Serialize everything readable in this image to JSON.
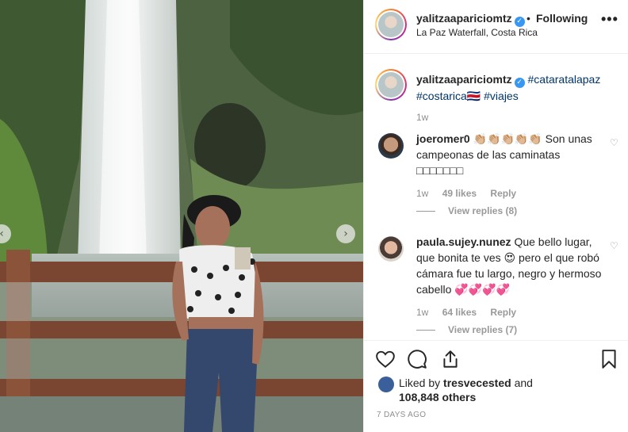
{
  "post": {
    "username": "yalitzaapariciomtz",
    "follow_status": "Following",
    "location": "La Paz Waterfall, Costa Rica",
    "caption_hashtags": [
      "#cataratalapaz",
      "#costarica",
      "#viajes"
    ],
    "caption_flag": "🇨🇷",
    "caption_time": "1w"
  },
  "comments": [
    {
      "username": "joeromer0",
      "text": "👏🏼👏🏼👏🏼👏🏼👏🏼 Son unas campeonas de las caminatas",
      "extra": "□□□□□□□",
      "time": "1w",
      "likes": "49 likes",
      "reply": "Reply",
      "view_replies": "View replies (8)"
    },
    {
      "username": "paula.sujey.nunez",
      "text": "Que bello lugar, que bonita te ves 😍 pero el que robó cámara fue tu largo, negro y hermoso cabello 💞💞💞💞",
      "time": "1w",
      "likes": "64 likes",
      "reply": "Reply",
      "view_replies": "View replies (7)"
    }
  ],
  "likes_section": {
    "liked_by_prefix": "Liked by",
    "liked_by_user": "tresvecested",
    "liked_by_and": "and",
    "others": "108,848 others",
    "posted_ago": "7 DAYS AGO"
  },
  "icons": [
    "more-options-icon",
    "heart-icon",
    "comment-icon",
    "share-icon",
    "bookmark-icon",
    "verified-icon",
    "chevron-left-icon",
    "chevron-right-icon"
  ],
  "colors": {
    "hashtag": "#003569",
    "verified": "#3897f0",
    "muted": "#8e8e8e"
  }
}
